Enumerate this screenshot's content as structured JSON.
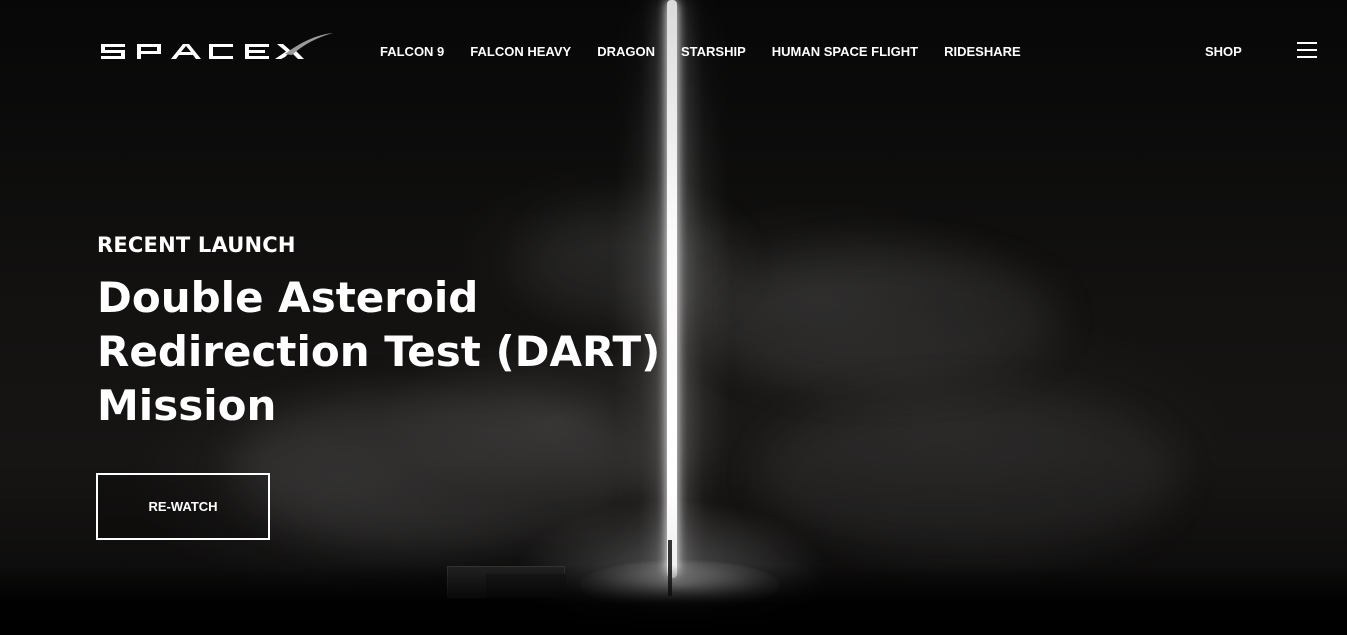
{
  "header": {
    "logo_alt": "SpaceX",
    "nav": [
      {
        "label": "FALCON 9"
      },
      {
        "label": "FALCON HEAVY"
      },
      {
        "label": "DRAGON"
      },
      {
        "label": "STARSHIP"
      },
      {
        "label": "HUMAN SPACE FLIGHT"
      },
      {
        "label": "RIDESHARE"
      }
    ],
    "shop_label": "SHOP"
  },
  "hero": {
    "eyebrow": "RECENT LAUNCH",
    "title_lines": [
      "Double Asteroid",
      "Redirection Test (DART)",
      "Mission"
    ],
    "button_label": "RE-WATCH"
  },
  "icons": {
    "menu": "hamburger-menu-icon"
  }
}
